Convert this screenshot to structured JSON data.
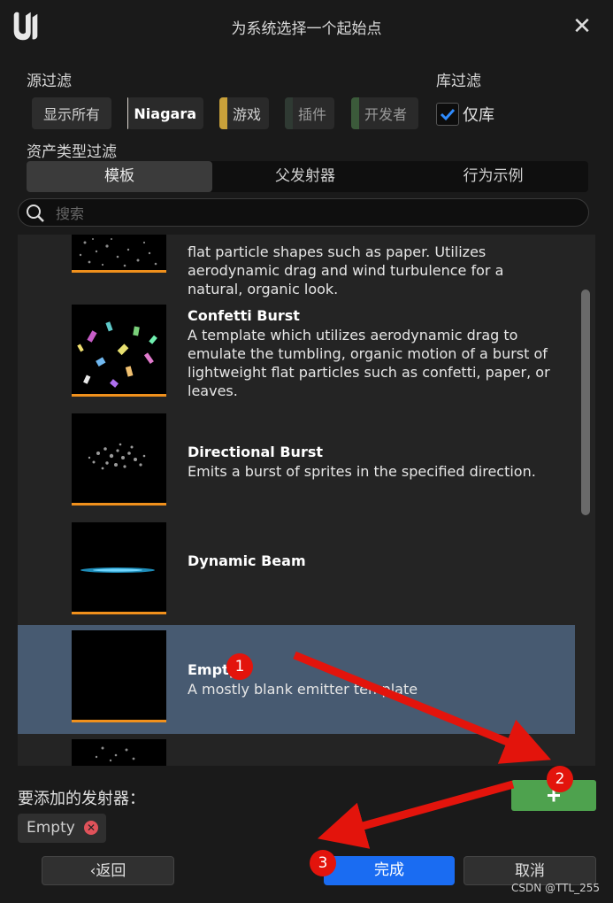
{
  "window": {
    "title": "为系统选择一个起始点",
    "close_icon": "close-icon"
  },
  "source_filter": {
    "label": "源过滤",
    "chips": [
      {
        "label": "显示所有",
        "color": ""
      },
      {
        "label": "Niagara",
        "color": "#d9d2cc"
      },
      {
        "label": "游戏",
        "color": "#c9a13a"
      },
      {
        "label": "插件",
        "color": "#2f3a33"
      },
      {
        "label": "开发者",
        "color": "#3b5a3a"
      }
    ]
  },
  "library_filter": {
    "label": "库过滤",
    "checkbox_label": "仅库",
    "checked": true
  },
  "asset_type_filter": {
    "label": "资产类型过滤",
    "tabs": [
      "模板",
      "父发射器",
      "行为示例"
    ],
    "active_tab": 0
  },
  "search": {
    "placeholder": "搜索",
    "value": ""
  },
  "templates": [
    {
      "title": "",
      "description": "flat particle shapes such as paper. Utilizes aerodynamic drag and wind turbulence for a natural, organic look.",
      "selected": false
    },
    {
      "title": "Confetti Burst",
      "description": "A template which utilizes aerodynamic drag to emulate the tumbling, organic motion of a burst of lightweight flat particles such as confetti, paper, or leaves.",
      "selected": false
    },
    {
      "title": "Directional Burst",
      "description": "Emits a burst of sprites in the specified direction.",
      "selected": false
    },
    {
      "title": "Dynamic Beam",
      "description": "",
      "selected": false
    },
    {
      "title": "Empty",
      "description": "A mostly blank emitter template",
      "selected": true
    }
  ],
  "emitters_to_add": {
    "label": "要添加的发射器：",
    "items": [
      "Empty"
    ]
  },
  "buttons": {
    "add": "+",
    "back": "返回",
    "done": "完成",
    "cancel": "取消"
  },
  "annotations": [
    "1",
    "2",
    "3"
  ],
  "watermark": "CSDN @TTL_255",
  "colors": {
    "accent_blue": "#1a6cf2",
    "add_green": "#4ea24e",
    "selection": "#475a71",
    "thumb_underline": "#f0901c",
    "annotation_red": "#e3140c"
  }
}
